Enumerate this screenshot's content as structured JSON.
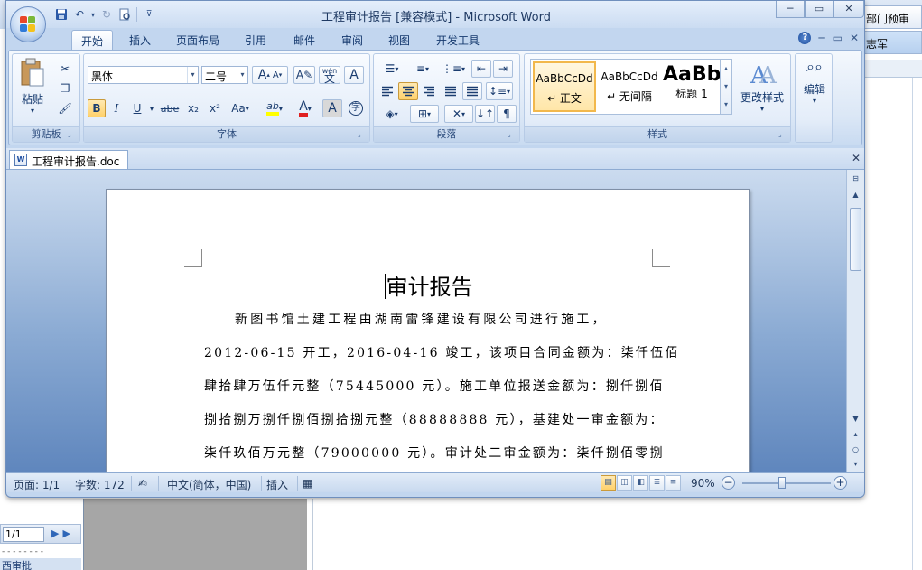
{
  "background_app": {
    "tab_1": "部门预审",
    "tab_2": "志军",
    "right_panel_text": "",
    "pager_value": "1/1",
    "bottom_item": "西审批"
  },
  "window": {
    "title": "工程审计报告 [兼容模式] - Microsoft Word"
  },
  "ribbon": {
    "tabs": [
      "开始",
      "插入",
      "页面布局",
      "引用",
      "邮件",
      "审阅",
      "视图",
      "开发工具"
    ],
    "active_tab": "开始",
    "clipboard": {
      "paste_label": "粘贴",
      "group_label": "剪贴板"
    },
    "font": {
      "font_name": "黑体",
      "font_size": "二号",
      "group_label": "字体",
      "bold": "B",
      "italic": "I",
      "underline": "U",
      "strike": "abe",
      "subscript": "x₂",
      "superscript": "x²",
      "change_case": "Aa",
      "grow": "A",
      "shrink": "A",
      "phonetic": "wén",
      "char_border": "A",
      "highlight": "ab",
      "font_color": "A",
      "char_shading": "A",
      "enclose": "字"
    },
    "paragraph": {
      "group_label": "段落"
    },
    "styles": {
      "items": [
        {
          "sample": "AaBbCcDd",
          "name": "↵ 正文"
        },
        {
          "sample": "AaBbCcDd",
          "name": "↵ 无间隔"
        },
        {
          "sample": "AaBb",
          "name": "标题 1"
        }
      ],
      "change_styles_label": "更改样式",
      "group_label": "样式"
    },
    "editing": {
      "label": "编辑"
    }
  },
  "document_tab": {
    "filename": "工程审计报告.doc"
  },
  "document": {
    "title": "审计报告",
    "lines": [
      "新图书馆土建工程由湖南雷锋建设有限公司进行施工，",
      "2012-06-15 开工，2016-04-16 竣工，该项目合同金额为：柒仟伍佰",
      "肆拾肆万伍仟元整（75445000 元）。施工单位报送金额为：捌仟捌佰",
      "捌拾捌万捌仟捌佰捌拾捌元整（88888888 元），基建处一审金额为：",
      "柒仟玖佰万元整（79000000 元）。审计处二审金额为：柒仟捌佰零捌"
    ]
  },
  "statusbar": {
    "page": "页面: 1/1",
    "words": "字数: 172",
    "language": "中文(简体，中国)",
    "mode": "插入",
    "zoom": "90%",
    "zoom_level": 0.45
  }
}
